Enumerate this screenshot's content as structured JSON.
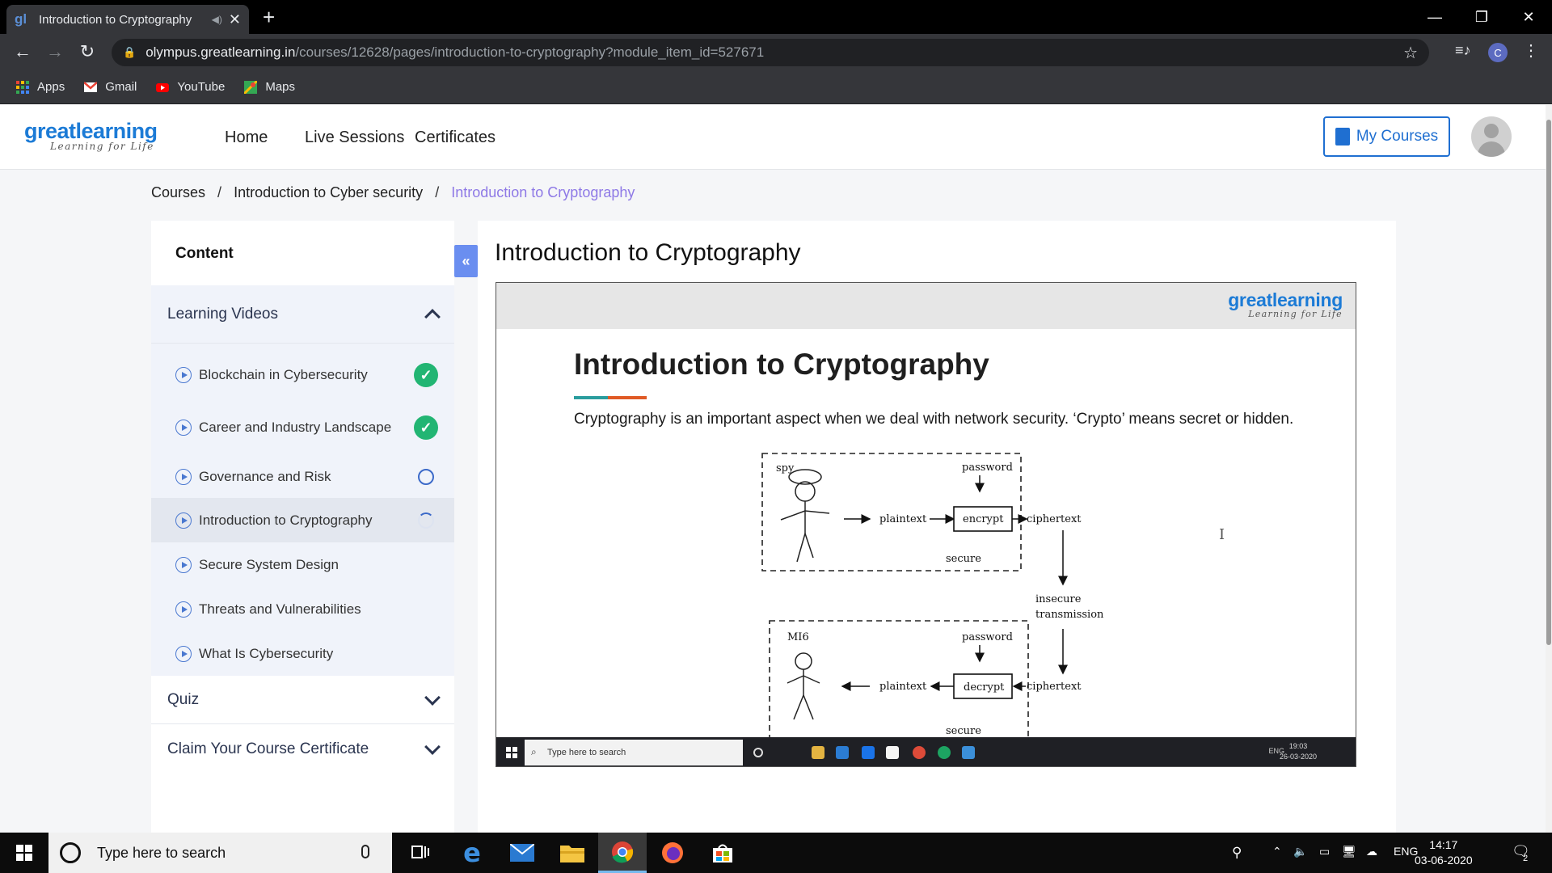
{
  "browser": {
    "tab_title": "Introduction to Cryptography",
    "url_host": "olympus.greatlearning.in",
    "url_path": "/courses/12628/pages/introduction-to-cryptography?module_item_id=527671",
    "profile_initial": "C",
    "bookmarks": [
      {
        "label": "Apps",
        "icon": "apps-grid-icon"
      },
      {
        "label": "Gmail",
        "icon": "gmail-icon"
      },
      {
        "label": "YouTube",
        "icon": "youtube-icon"
      },
      {
        "label": "Maps",
        "icon": "maps-icon"
      }
    ]
  },
  "site": {
    "logo_word_a": "great",
    "logo_word_b": "learning",
    "logo_tagline": "Learning for Life",
    "nav": [
      "Home",
      "Live Sessions",
      "Certificates"
    ],
    "my_courses": "My Courses"
  },
  "breadcrumb": {
    "items": [
      "Courses",
      "Introduction to Cyber security"
    ],
    "current": "Introduction to Cryptography",
    "separator": "/"
  },
  "sidebar": {
    "header": "Content",
    "sections": [
      {
        "label": "Learning Videos",
        "expanded": true
      },
      {
        "label": "Quiz",
        "expanded": false
      },
      {
        "label": "Claim Your Course Certificate",
        "expanded": false
      }
    ],
    "items": [
      {
        "label": "Blockchain in Cybersecurity",
        "status": "done"
      },
      {
        "label": "Career and Industry Landscape",
        "status": "done"
      },
      {
        "label": "Governance and Risk",
        "status": "pending"
      },
      {
        "label": "Introduction to Cryptography",
        "status": "in-progress"
      },
      {
        "label": "Secure System Design",
        "status": "none"
      },
      {
        "label": "Threats and Vulnerabilities",
        "status": "none"
      },
      {
        "label": "What Is Cybersecurity",
        "status": "none"
      }
    ],
    "collapse_glyph": "«"
  },
  "main": {
    "title": "Introduction to Cryptography"
  },
  "slide": {
    "logo_word": "greatlearning",
    "logo_tagline": "Learning for Life",
    "title": "Introduction to Cryptography",
    "body": "Cryptography is an important aspect when we deal with network security. ‘Crypto’ means secret or hidden.",
    "diagram": {
      "spy": "spy",
      "password_top": "password",
      "plaintext_top": "plaintext",
      "encrypt": "encrypt",
      "ciphertext_top": "ciphertext",
      "secure_top": "secure",
      "insecure_1": "insecure",
      "insecure_2": "transmission",
      "mi6": "MI6",
      "password_bottom": "password",
      "plaintext_bottom": "plaintext",
      "decrypt": "decrypt",
      "ciphertext_bottom": "ciphertext",
      "secure_bottom": "secure"
    },
    "taskbar_search": "Type here to search",
    "taskbar_lang": "ENG",
    "taskbar_time": "19:03",
    "taskbar_date": "26-03-2020"
  },
  "taskbar": {
    "search_placeholder": "Type here to search",
    "lang": "ENG",
    "time": "14:17",
    "date": "03-06-2020",
    "notification_count": "2"
  }
}
